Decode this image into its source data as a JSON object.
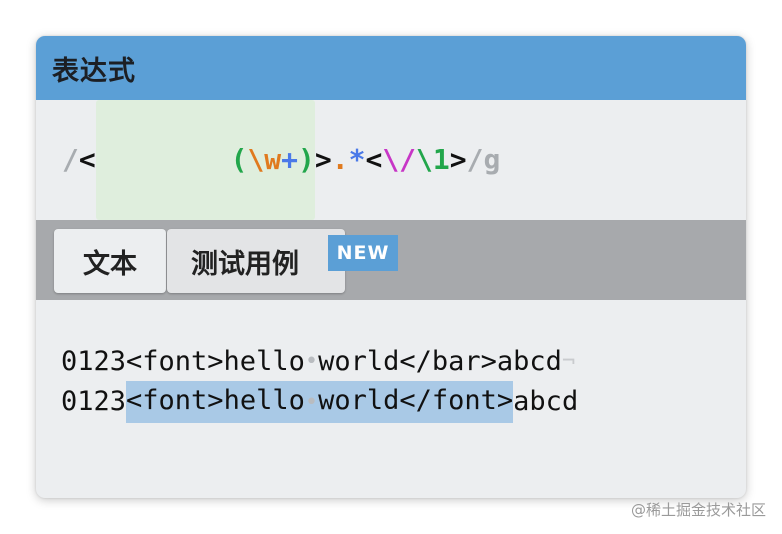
{
  "header": {
    "title": "表达式"
  },
  "expression": {
    "tokens": [
      {
        "text": "/",
        "color": "#a8acb0",
        "role": "delimiter"
      },
      {
        "text": "<",
        "color": "#111111",
        "role": "literal"
      },
      {
        "text": "(",
        "color": "#22a64b",
        "role": "group-open"
      },
      {
        "text": "\\w",
        "color": "#e07a1e",
        "role": "char-class"
      },
      {
        "text": "+",
        "color": "#4a79e8",
        "role": "quantifier"
      },
      {
        "text": ")",
        "color": "#22a64b",
        "role": "group-close"
      },
      {
        "text": ">",
        "color": "#111111",
        "role": "literal"
      },
      {
        "text": ".",
        "color": "#e07a1e",
        "role": "dot"
      },
      {
        "text": "*",
        "color": "#4a79e8",
        "role": "quantifier"
      },
      {
        "text": "<",
        "color": "#111111",
        "role": "literal"
      },
      {
        "text": "\\/",
        "color": "#c736c6",
        "role": "escape"
      },
      {
        "text": "\\1",
        "color": "#22a64b",
        "role": "backreference"
      },
      {
        "text": ">",
        "color": "#111111",
        "role": "literal"
      },
      {
        "text": "/g",
        "color": "#a8acb0",
        "role": "flags"
      }
    ]
  },
  "tabs": [
    {
      "label": "文本",
      "active": true
    },
    {
      "label": "测试用例",
      "active": false
    }
  ],
  "badge": {
    "label": "NEW"
  },
  "text_lines": [
    {
      "pre": "0123<font>hello",
      "mid": "world</bar>abcd",
      "post": "",
      "space_marker": "•",
      "eol_marker": "¬",
      "matched": false
    },
    {
      "pre": "0123",
      "match_a": "<font>hello",
      "match_b": "world</font>",
      "post": "abcd",
      "space_marker": "•",
      "matched": true
    }
  ],
  "watermark": "@稀土掘金技术社区"
}
